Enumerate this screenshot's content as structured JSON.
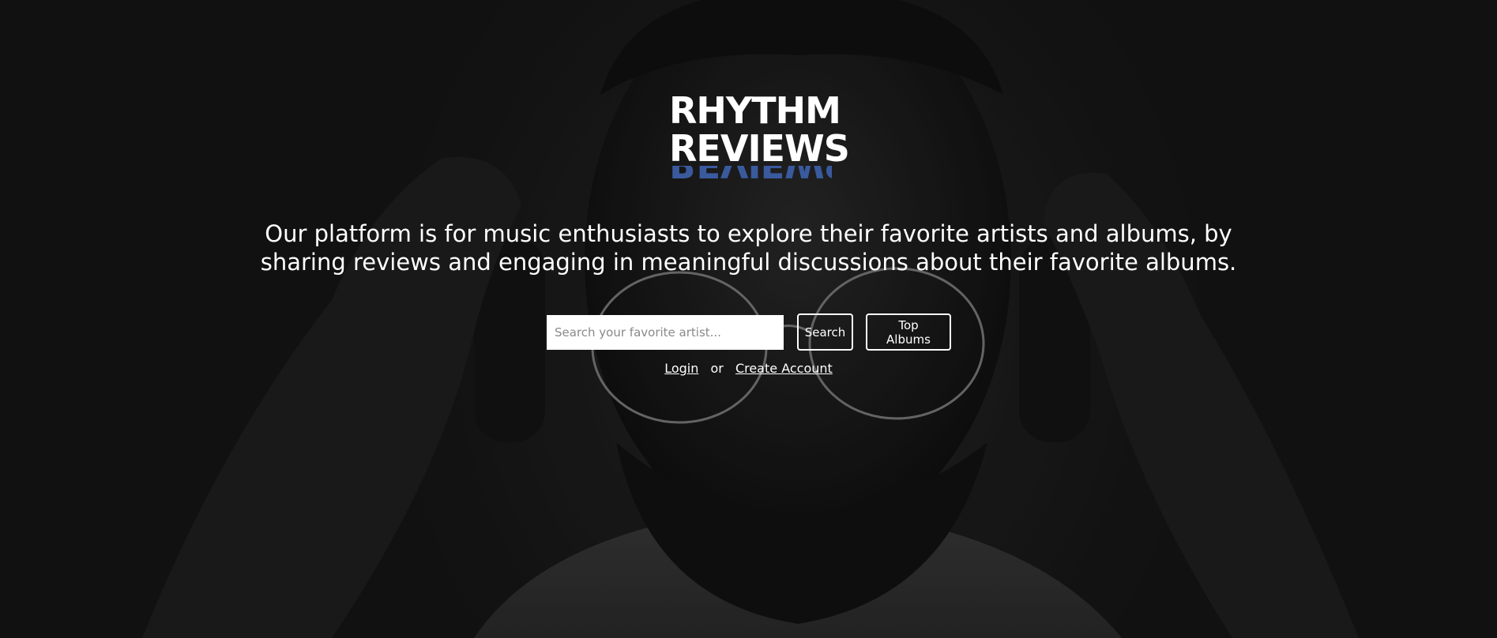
{
  "brand": {
    "line1": "RHYTHM",
    "line2": "REVIEWS",
    "reflection": "REVIEWS",
    "reflection_color": "#3a5a9e"
  },
  "tagline": "Our platform is for music enthusiasts to explore their favorite artists and albums, by sharing reviews and engaging in meaningful discussions about their favorite albums.",
  "search": {
    "value": "",
    "placeholder": "Search your favorite artist..."
  },
  "buttons": {
    "search_label": "Search",
    "top_albums_label": "Top Albums"
  },
  "auth": {
    "login_label": "Login",
    "separator": "or",
    "create_account_label": "Create Account"
  },
  "colors": {
    "text": "#ffffff",
    "background": "#1a1a1a"
  }
}
